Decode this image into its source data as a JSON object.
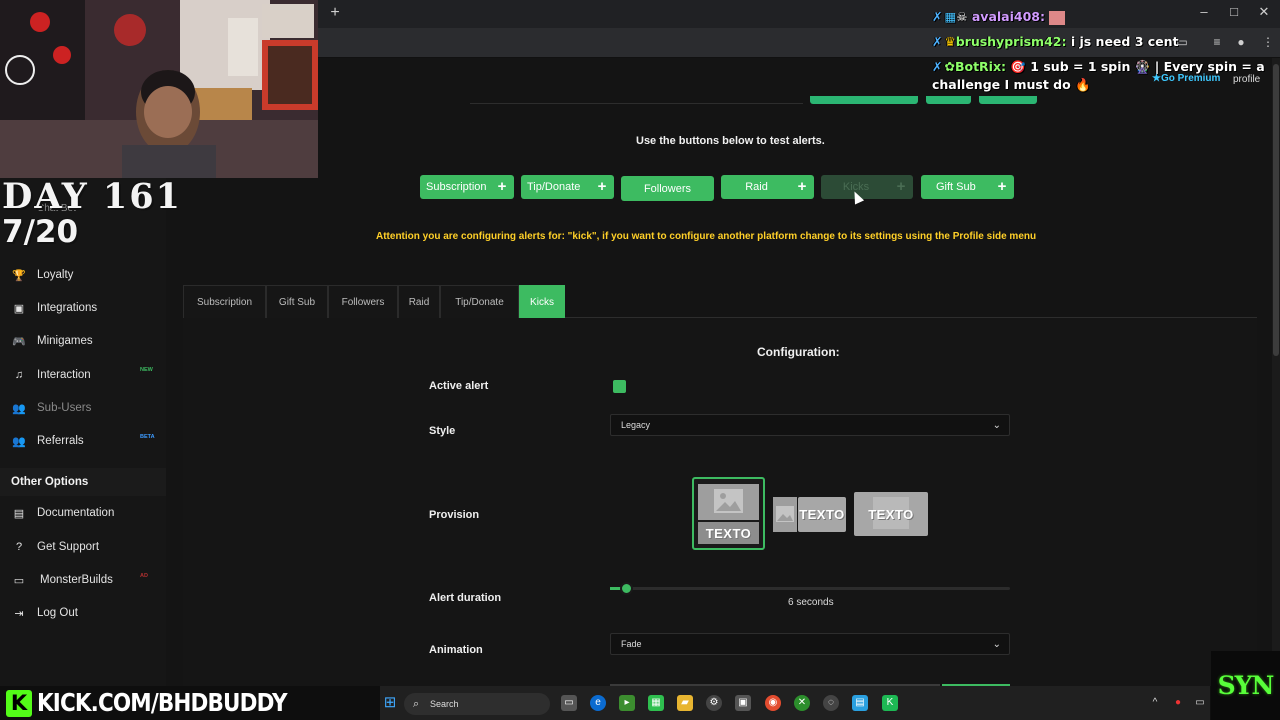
{
  "browser": {
    "new_tab": "+",
    "win_minimize": "–",
    "win_maximize": "□",
    "win_close": "✕"
  },
  "main": {
    "hint": "Use the buttons below to test alerts.",
    "test_buttons": [
      {
        "label": "Subscription",
        "plus": "+"
      },
      {
        "label": "Tip/Donate",
        "plus": "+"
      },
      {
        "label": "Followers"
      },
      {
        "label": "Raid",
        "plus": "+"
      },
      {
        "label": "Kicks",
        "plus": "+"
      },
      {
        "label": "Gift Sub",
        "plus": "+"
      }
    ],
    "attention": "Attention you are configuring alerts for: \"kick\", if you want to configure another platform change to its settings using the Profile side menu",
    "tabs": [
      "Subscription",
      "Gift Sub",
      "Followers",
      "Raid",
      "Tip/Donate",
      "Kicks"
    ],
    "active_tab": "Kicks",
    "config": {
      "title": "Configuration:",
      "active_alert_label": "Active alert",
      "style_label": "Style",
      "style_value": "Legacy",
      "provision_label": "Provision",
      "provision_text": "TEXTO",
      "duration_label": "Alert duration",
      "duration_value": "6 seconds",
      "duration_fraction": 0.04,
      "animation_label": "Animation",
      "animation_value": "Fade"
    }
  },
  "sidebar": {
    "items": [
      {
        "label": "Loyalty",
        "icon": "trophy-icon",
        "glyph": "🏆"
      },
      {
        "label": "Integrations",
        "icon": "integrations-icon",
        "glyph": "▣"
      },
      {
        "label": "Minigames",
        "icon": "gamepad-icon",
        "glyph": "🎮"
      },
      {
        "label": "Interaction",
        "icon": "music-icon",
        "glyph": "♫",
        "badge": "NEW"
      },
      {
        "label": "Sub-Users",
        "icon": "sub-users-icon",
        "glyph": "👥"
      },
      {
        "label": "Referrals",
        "icon": "referrals-icon",
        "glyph": "👥",
        "badge": "BETA"
      }
    ],
    "other_options_title": "Other Options",
    "other_items": [
      {
        "label": "Documentation",
        "icon": "documentation-icon",
        "glyph": "▤"
      },
      {
        "label": "Get Support",
        "icon": "help-icon",
        "glyph": "?"
      },
      {
        "label": "MonsterBuilds",
        "icon": "monitor-icon",
        "glyph": "▭",
        "badge": "AD"
      },
      {
        "label": "Log Out",
        "icon": "logout-icon",
        "glyph": "⇥"
      }
    ],
    "hidden_item": "Chat Bot"
  },
  "overlay": {
    "day": "DAY 161",
    "date": "7/20",
    "chat": [
      {
        "user": "avalai408:",
        "msg": ""
      },
      {
        "user": "brushyprism42:",
        "msg": "i js need 3 cent"
      },
      {
        "user": "BotRix:",
        "msg": "🎯 1 sub = 1 spin 🎡 | Every spin = a"
      },
      {
        "user": "",
        "msg": "challenge I must do 🔥"
      }
    ],
    "go_premium": "Go Premium",
    "profile": "profile",
    "kick_url": "KICK.COM/BHDBUDDY",
    "kick_letter": "K",
    "syn_logo": "SYN"
  },
  "taskbar": {
    "search_placeholder": "Search"
  },
  "colors": {
    "accent": "#3dbb61",
    "warning": "#ffd028",
    "kick_green": "#53fc18"
  }
}
